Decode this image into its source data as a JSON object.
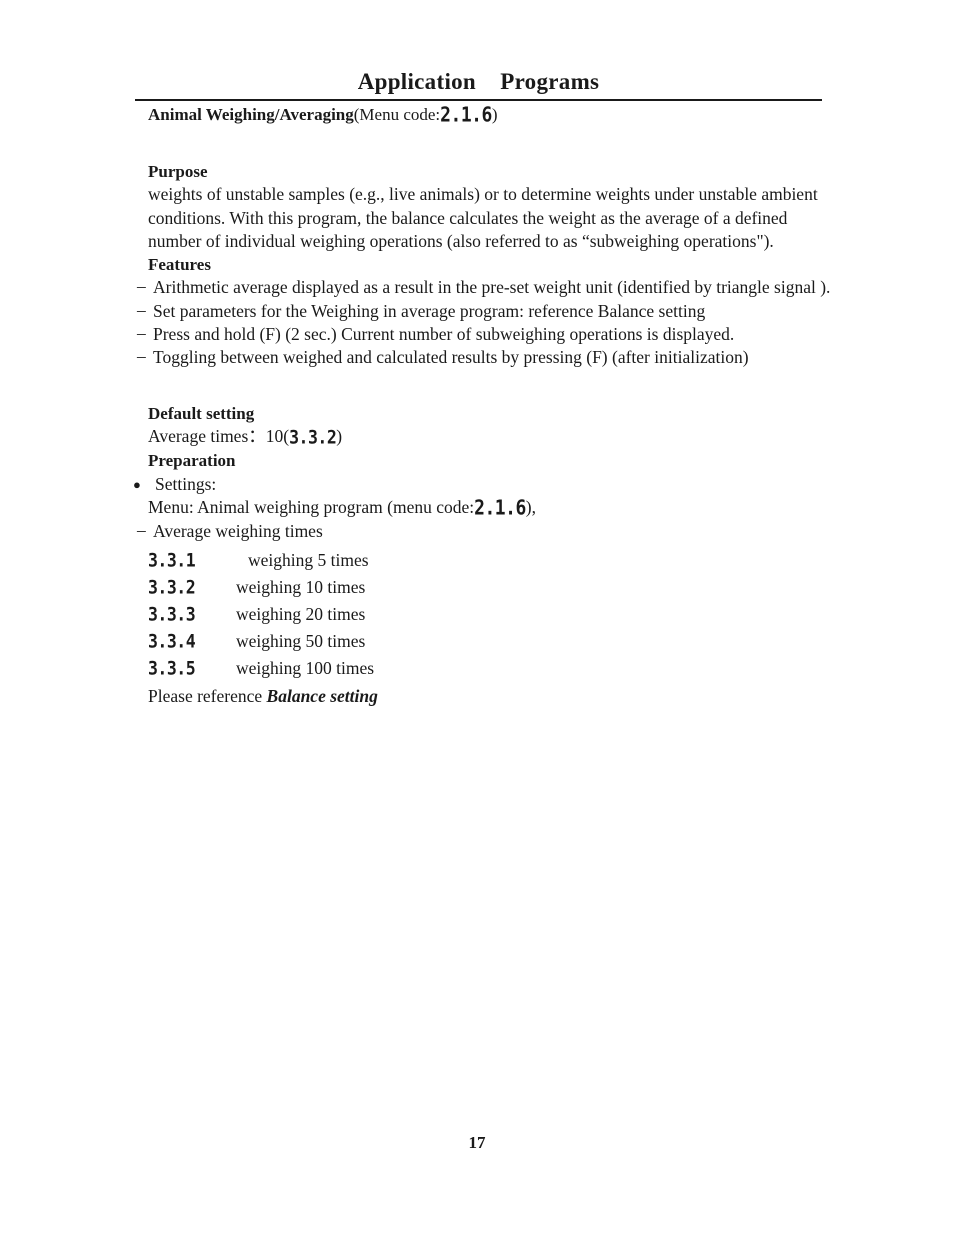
{
  "header": {
    "title": "Application    Programs"
  },
  "section": {
    "heading_bold": "Animal Weighing/Averaging",
    "heading_rest_prefix": "(Menu code:",
    "heading_code": "2.1.6",
    "heading_rest_suffix": ")"
  },
  "purpose": {
    "heading": "Purpose",
    "body": "weights of unstable samples (e.g., live animals) or to determine weights under unstable ambient conditions. With this program, the balance calculates the weight as the average of a defined number of individual weighing operations (also referred to as “subweighing operations\")."
  },
  "features": {
    "heading": "Features",
    "dash": "–",
    "items": [
      "Arithmetic average displayed as a result in the pre-set weight unit (identified by triangle signal ).",
      "Set parameters for the Weighing in average program: reference Balance setting",
      "Press and hold (F) (2 sec.) Current number of subweighing operations is displayed.",
      "Toggling between weighed and calculated results by pressing (F) (after initialization)"
    ]
  },
  "default_setting": {
    "heading": "Default setting",
    "average_times_label": "Average times：",
    "average_times_value": "10(",
    "average_times_code": "3.3.2",
    "average_times_suffix": ")"
  },
  "preparation": {
    "heading": "Preparation",
    "bullet": "●",
    "settings_label": "Settings:",
    "menu_line_prefix": "Menu: Animal weighing program (menu code:",
    "menu_line_code": "2.1.6",
    "menu_line_suffix": "),",
    "dash": "–",
    "average_weighing_times_label": "Average weighing times",
    "codes": [
      {
        "code": "3.3.1",
        "label": "weighing 5 times"
      },
      {
        "code": "3.3.2",
        "label": "weighing 10 times"
      },
      {
        "code": "3.3.3",
        "label": "weighing 20 times"
      },
      {
        "code": "3.3.4",
        "label": "weighing 50 times"
      },
      {
        "code": "3.3.5",
        "label": "weighing 100 times"
      }
    ],
    "reference_prefix": "Please reference ",
    "reference_bold_italic": "Balance setting"
  },
  "footer": {
    "page_number": "17"
  }
}
